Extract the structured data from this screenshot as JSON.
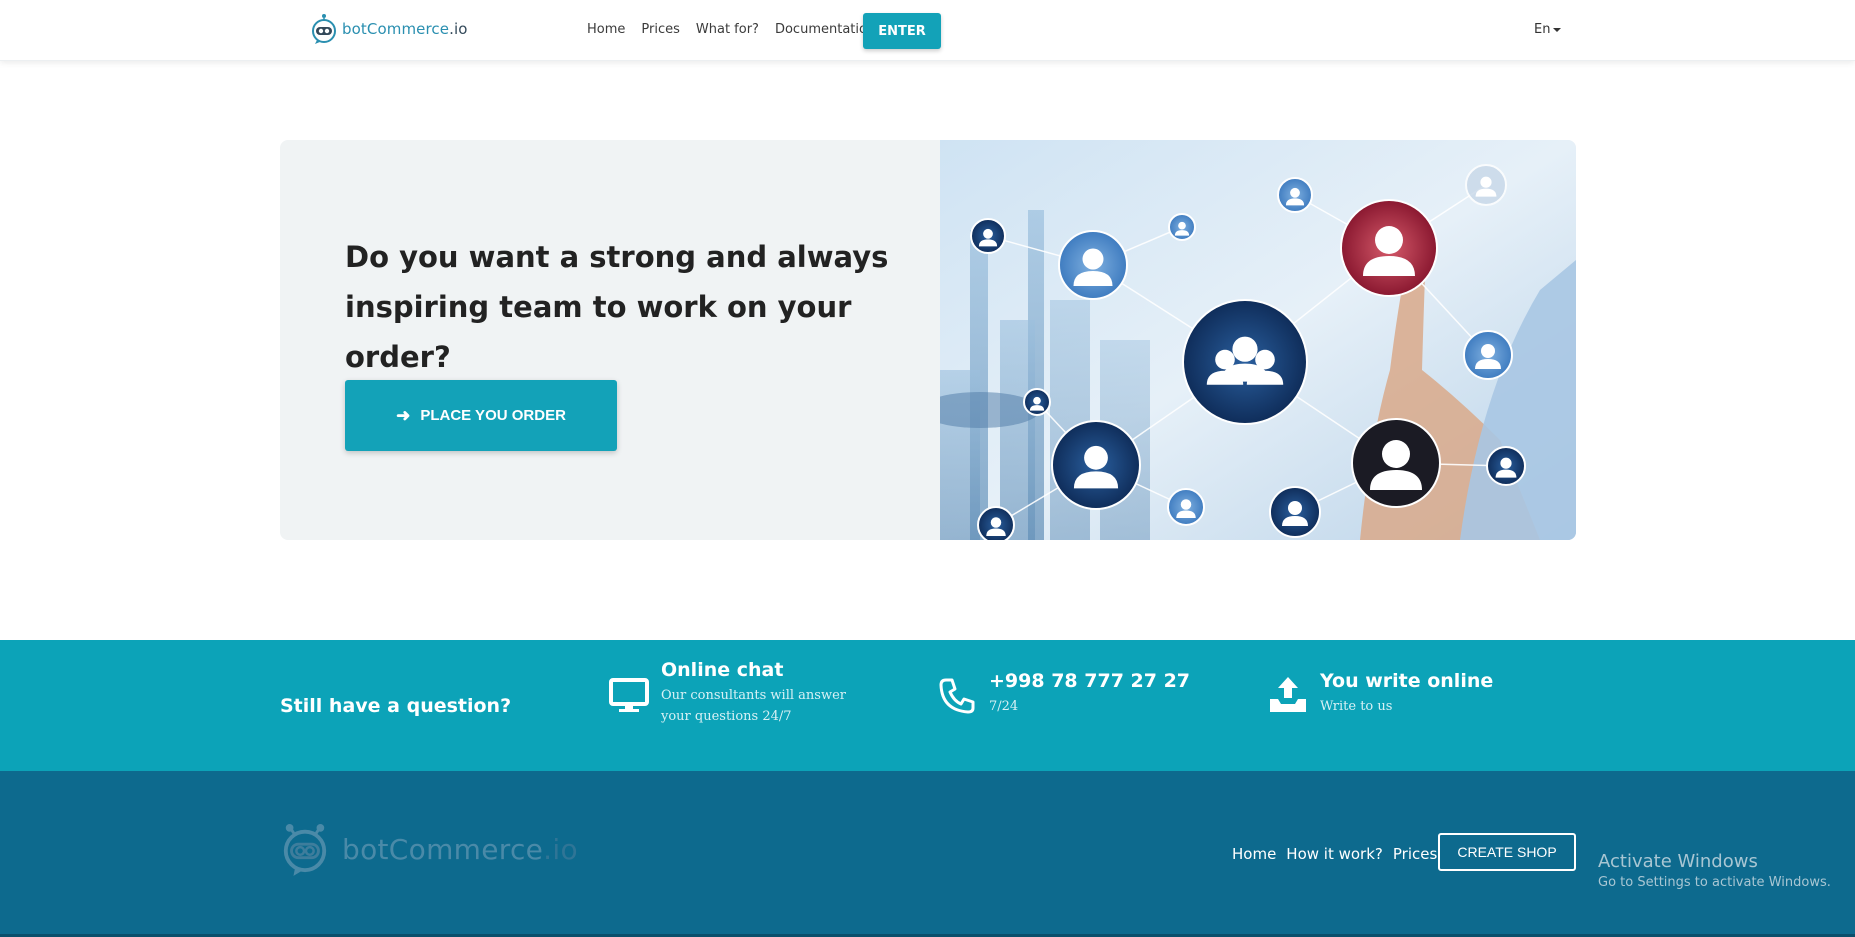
{
  "navbar": {
    "brand": {
      "name": "botCommerce",
      "tld": ".io"
    },
    "links": [
      "Home",
      "Prices",
      "What for?",
      "Documentation"
    ],
    "enter_label": "ENTER",
    "language": "En"
  },
  "hero": {
    "title": "Do you want a strong and always inspiring team to work on your order?",
    "cta_label": "PLACE YOU ORDER"
  },
  "contact": {
    "heading": "Still have a question?",
    "items": [
      {
        "icon": "monitor-icon",
        "title": "Online chat",
        "subtitle": "Our consultants will answer your questions 24/7"
      },
      {
        "icon": "phone-icon",
        "title": "+998 78 777 27 27",
        "subtitle": "7/24"
      },
      {
        "icon": "inbox-upload-icon",
        "title": "You write online",
        "subtitle": "Write to us"
      }
    ]
  },
  "footer": {
    "brand": {
      "name": "botCommerce",
      "tld": ".io"
    },
    "links": [
      "Home",
      "How it work?",
      "Prices"
    ],
    "cta_label": "CREATE SHOP"
  },
  "watermark": {
    "title": "Activate Windows",
    "subtitle": "Go to Settings to activate Windows."
  },
  "colors": {
    "accent": "#13a2b8",
    "contact_band": "#0ca3b8",
    "footer": "#0d6a8e"
  }
}
